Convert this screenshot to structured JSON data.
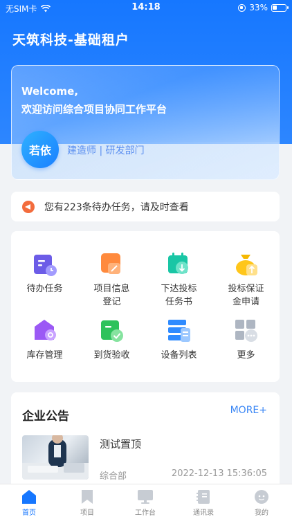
{
  "status_bar": {
    "carrier": "无SIM卡",
    "time": "14:18",
    "battery": "33%"
  },
  "header": {
    "title": "天筑科技-基础租户"
  },
  "welcome": {
    "greeting_en": "Welcome,",
    "greeting_cn": "欢迎访问综合项目协同工作平台",
    "avatar_text": "若依",
    "user_role": "建造师 | 研发部门"
  },
  "notice": {
    "text": "您有223条待办任务，请及时查看",
    "icon": "megaphone-icon"
  },
  "grid": {
    "items": [
      {
        "label": "待办任务",
        "icon": "todo-task-icon"
      },
      {
        "label": "项目信息\n登记",
        "icon": "project-info-icon"
      },
      {
        "label": "下达投标\n任务书",
        "icon": "bid-task-icon"
      },
      {
        "label": "投标保证\n金申请",
        "icon": "bid-deposit-icon"
      },
      {
        "label": "库存管理",
        "icon": "inventory-icon"
      },
      {
        "label": "到货验收",
        "icon": "arrival-check-icon"
      },
      {
        "label": "设备列表",
        "icon": "equipment-list-icon"
      },
      {
        "label": "更多",
        "icon": "more-icon"
      }
    ]
  },
  "announcements": {
    "title": "企业公告",
    "more_label": "MORE+",
    "items": [
      {
        "title": "测试置顶",
        "department": "综合部",
        "time": "2022-12-13 15:36:05"
      }
    ]
  },
  "tab_bar": {
    "tabs": [
      {
        "label": "首页",
        "active": true,
        "icon": "home-icon"
      },
      {
        "label": "项目",
        "active": false,
        "icon": "bookmark-icon"
      },
      {
        "label": "工作台",
        "active": false,
        "icon": "monitor-icon"
      },
      {
        "label": "通讯录",
        "active": false,
        "icon": "contacts-icon"
      },
      {
        "label": "我的",
        "active": false,
        "icon": "profile-icon"
      }
    ]
  },
  "colors": {
    "primary": "#1677ff",
    "accent_orange": "#f36c3d"
  }
}
